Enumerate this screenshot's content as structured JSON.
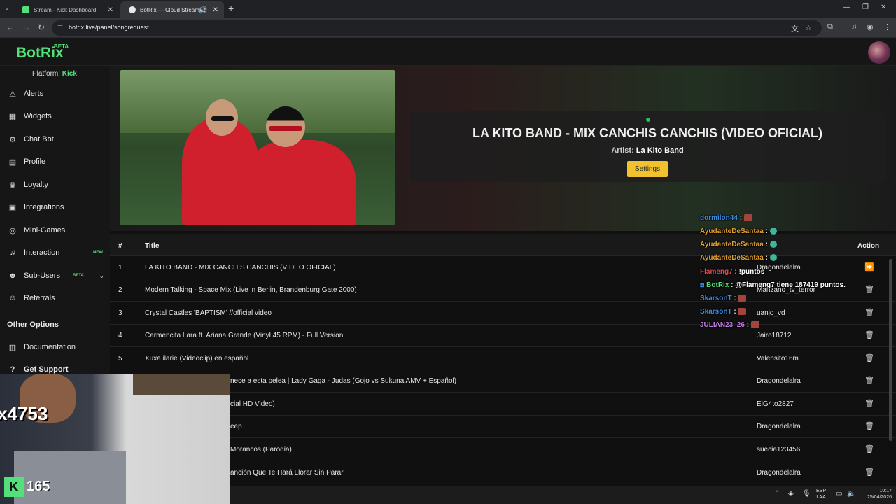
{
  "browser": {
    "tabs": [
      {
        "label": "Stream - Kick Dashboard",
        "favicon_color": "#53e07a"
      },
      {
        "label": "BotRix — Cloud Streaming",
        "favicon_color": "#e8e8e8"
      }
    ],
    "url": "botrix.live/panel/songrequest"
  },
  "app": {
    "logo": "BotRix",
    "logo_badge": "BETA"
  },
  "sidebar": {
    "platform_label": "Platform:",
    "platform_value": "Kick",
    "items": [
      {
        "label": "Alerts",
        "icon": "warning-icon"
      },
      {
        "label": "Widgets",
        "icon": "grid-icon"
      },
      {
        "label": "Chat Bot",
        "icon": "robot-icon"
      },
      {
        "label": "Profile",
        "icon": "id-card-icon"
      },
      {
        "label": "Loyalty",
        "icon": "trophy-icon"
      },
      {
        "label": "Integrations",
        "icon": "plug-icon"
      },
      {
        "label": "Mini-Games",
        "icon": "gamepad-icon"
      },
      {
        "label": "Interaction",
        "icon": "music-icon",
        "badge": "NEW"
      },
      {
        "label": "Sub-Users",
        "icon": "users-icon",
        "badge": "BETA"
      },
      {
        "label": "Referrals",
        "icon": "user-plus-icon"
      }
    ],
    "other_title": "Other Options",
    "other_items": [
      {
        "label": "Documentation",
        "icon": "book-icon"
      },
      {
        "label": "Get Support",
        "icon": "help-icon"
      }
    ]
  },
  "now_playing": {
    "title": "LA KITO BAND - MIX CANCHIS CANCHIS (VIDEO OFICIAL)",
    "artist_label": "Artist:",
    "artist": "La Kito Band",
    "settings_label": "Settings"
  },
  "queue": {
    "headers": {
      "num": "#",
      "title": "Title",
      "action": "Action"
    },
    "rows": [
      {
        "num": "1",
        "title": "LA KITO BAND - MIX CANCHIS CANCHIS (VIDEO OFICIAL)",
        "user": "Dragondelalra",
        "action": "skip"
      },
      {
        "num": "2",
        "title": "Modern Talking - Space Mix (Live in Berlin, Brandenburg Gate 2000)",
        "user": "Manzano_tv_terror",
        "action": "delete"
      },
      {
        "num": "3",
        "title": "Crystal Castles 'BAPTISM' //official video",
        "user": "uanjo_vd",
        "action": "delete"
      },
      {
        "num": "4",
        "title": "Carmencita Lara ft. Ariana Grande (Vinyl 45 RPM) - Full Version",
        "user": "Jairo18712",
        "action": "delete"
      },
      {
        "num": "5",
        "title": "Xuxa ilarie (Videoclip) en español",
        "user": "Valensito16m",
        "action": "delete"
      },
      {
        "num": "",
        "title": "nece a esta pelea | Lady Gaga - Judas (Gojo vs Sukuna AMV + Español)",
        "user": "Dragondelalra",
        "action": "delete"
      },
      {
        "num": "",
        "title": "cial HD Video)",
        "user": "ElG4to2827",
        "action": "delete"
      },
      {
        "num": "",
        "title": "eep",
        "user": "Dragondelalra",
        "action": "delete"
      },
      {
        "num": "",
        "title": "Morancos (Parodia)",
        "user": "suecia123456",
        "action": "delete"
      },
      {
        "num": "",
        "title": "anción Que Te Hará Llorar Sin Parar",
        "user": "Dragondelalra",
        "action": "delete"
      }
    ]
  },
  "chat": [
    {
      "user": "dormilon44",
      "color": "#3a8ae0",
      "sep": ":",
      "text": "",
      "emote": "red"
    },
    {
      "user": "AyudanteDeSantaa",
      "color": "#e0a030",
      "sep": ":",
      "text": "",
      "emote": "green"
    },
    {
      "user": "AyudanteDeSantaa",
      "color": "#e0a030",
      "sep": ":",
      "text": "",
      "emote": "green"
    },
    {
      "user": "AyudanteDeSantaa",
      "color": "#e0a030",
      "sep": ":",
      "text": "",
      "emote": "green"
    },
    {
      "user": "Flameng7",
      "color": "#e04a4a",
      "sep": ":",
      "text": "!puntos",
      "emote": ""
    },
    {
      "user": "BotRix",
      "color": "#53e07a",
      "sep": ":",
      "text": "@Flameng7 tiene 187419 puntos.",
      "emote": ""
    },
    {
      "user": "SkarsonT",
      "color": "#3a8ae0",
      "sep": ":",
      "text": "",
      "emote": "red"
    },
    {
      "user": "SkarsonT",
      "color": "#3a8ae0",
      "sep": ":",
      "text": "",
      "emote": "red"
    },
    {
      "user": "JULIAN23_26",
      "color": "#c07ae0",
      "sep": ":",
      "text": "",
      "emote": "red"
    }
  ],
  "webcam": {
    "overlay_text": "x4753",
    "kick_count": "165"
  },
  "taskbar": {
    "lang_top": "ESP",
    "lang_bottom": "LAA",
    "time": "10:17",
    "date": "25/04/2026"
  },
  "colors": {
    "brand_green": "#53e07a",
    "settings_button": "#f2c12e"
  }
}
